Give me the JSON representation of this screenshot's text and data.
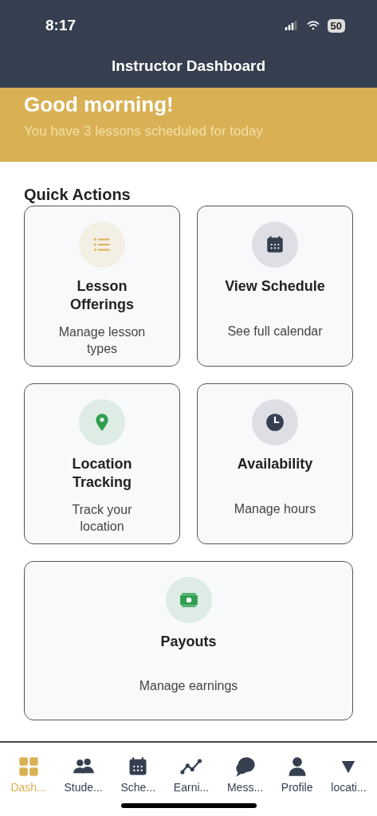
{
  "status_bar": {
    "time": "8:17",
    "battery": "50"
  },
  "header": {
    "title": "Instructor Dashboard"
  },
  "greeting": {
    "title": "Good morning!",
    "subtitle": "You have 3 lessons scheduled for today"
  },
  "quick_actions": {
    "title": "Quick Actions",
    "cards": [
      {
        "kind": "list",
        "color": "#d9b154",
        "title": "Lesson Offerings",
        "subtitle": "Manage lesson types"
      },
      {
        "kind": "calendar",
        "color": "#353f4f",
        "title": "View Schedule",
        "subtitle": "See full calendar"
      },
      {
        "kind": "pin",
        "color": "#2f9e4f",
        "title": "Location Tracking",
        "subtitle": "Track your location"
      },
      {
        "kind": "clock",
        "color": "#353f4f",
        "title": "Availability",
        "subtitle": "Manage hours"
      },
      {
        "kind": "money",
        "color": "#2f9e4f",
        "title": "Payouts",
        "subtitle": "Manage earnings"
      }
    ]
  },
  "tab_bar": [
    {
      "kind": "grid",
      "label": "Dash...",
      "selected": true
    },
    {
      "kind": "people",
      "label": "Stude...",
      "selected": false
    },
    {
      "kind": "calendar",
      "label": "Sche...",
      "selected": false
    },
    {
      "kind": "chart",
      "label": "Earni...",
      "selected": false
    },
    {
      "kind": "chat",
      "label": "Mess...",
      "selected": false
    },
    {
      "kind": "person",
      "label": "Profile",
      "selected": false
    },
    {
      "kind": "triangle",
      "label": "locati...",
      "selected": false
    }
  ]
}
